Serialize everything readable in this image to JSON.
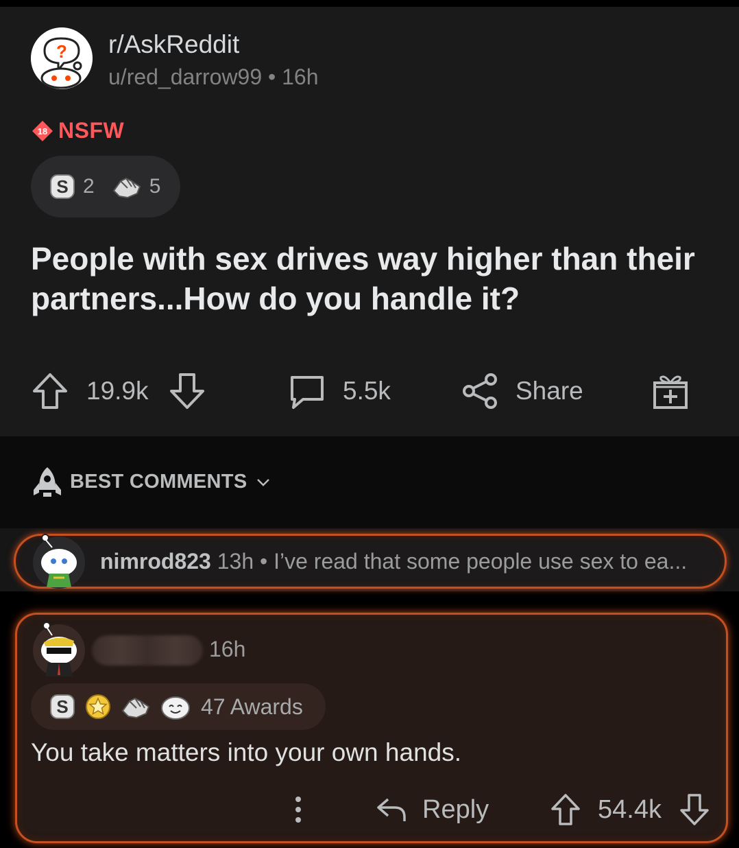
{
  "post": {
    "subreddit": "r/AskReddit",
    "author": "u/red_darrow99",
    "separator": "•",
    "age": "16h",
    "nsfw_badge": "18",
    "nsfw_label": "NSFW",
    "awards": [
      {
        "icon": "silver-award-icon",
        "count": "2"
      },
      {
        "icon": "helpful-award-icon",
        "count": "5"
      }
    ],
    "title": "People with sex drives way higher than their partners...How do you handle it?",
    "upvotes": "19.9k",
    "comments": "5.5k",
    "share_label": "Share"
  },
  "sort": {
    "label": "BEST COMMENTS"
  },
  "collapsed_comment": {
    "author": "nimrod823",
    "age": "13h",
    "separator": "•",
    "preview": "I’ve read that some people use sex to ea..."
  },
  "comment": {
    "age": "16h",
    "awards_label": "47 Awards",
    "award_icons": [
      "silver-award-icon",
      "gold-award-icon",
      "helpful-award-icon",
      "wholesome-award-icon"
    ],
    "body": "You take matters into your own hands.",
    "reply_label": "Reply",
    "score": "54.4k"
  },
  "colors": {
    "background": "#1a1a1b",
    "nsfw": "#ff585b",
    "highlight_border": "#c4501f",
    "text_muted": "#818384"
  }
}
